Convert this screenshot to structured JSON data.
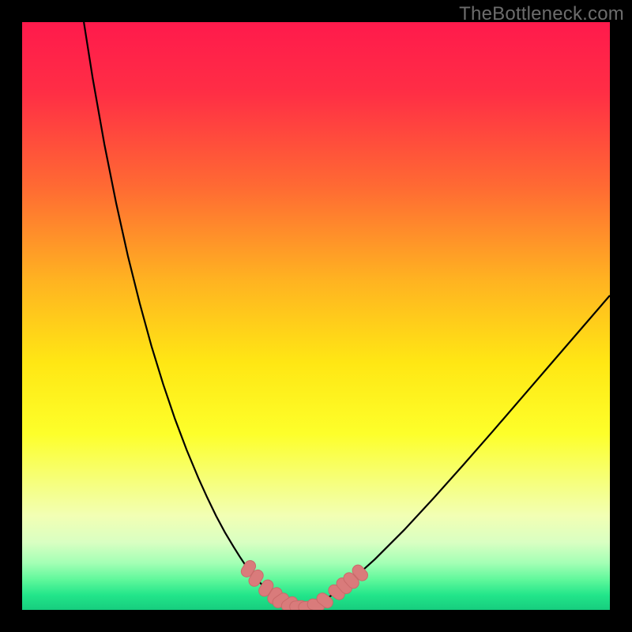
{
  "watermark": "TheBottleneck.com",
  "colors": {
    "frame": "#000000",
    "gradient_stops": [
      {
        "offset": 0.0,
        "color": "#ff1a4c"
      },
      {
        "offset": 0.12,
        "color": "#ff2e45"
      },
      {
        "offset": 0.28,
        "color": "#ff6a33"
      },
      {
        "offset": 0.44,
        "color": "#ffb321"
      },
      {
        "offset": 0.58,
        "color": "#ffe714"
      },
      {
        "offset": 0.7,
        "color": "#fdff2a"
      },
      {
        "offset": 0.78,
        "color": "#f6ff7a"
      },
      {
        "offset": 0.84,
        "color": "#f2ffb4"
      },
      {
        "offset": 0.885,
        "color": "#d9ffc2"
      },
      {
        "offset": 0.92,
        "color": "#a4ffb5"
      },
      {
        "offset": 0.95,
        "color": "#5cf79a"
      },
      {
        "offset": 0.975,
        "color": "#22e58a"
      },
      {
        "offset": 1.0,
        "color": "#17cd7e"
      }
    ],
    "curve": "#000000",
    "marker_fill": "#d97b7b",
    "marker_stroke": "#c96a6a"
  },
  "chart_data": {
    "type": "line",
    "title": "",
    "xlabel": "",
    "ylabel": "",
    "xlim": [
      0,
      100
    ],
    "ylim": [
      0,
      100
    ],
    "grid": false,
    "legend": false,
    "x": [
      10.5,
      12,
      14,
      16,
      18,
      20,
      22,
      24,
      26,
      28,
      30,
      31.5,
      33,
      34.5,
      36,
      37,
      38,
      39,
      40,
      41,
      42,
      43.5,
      45,
      47,
      49,
      51,
      53,
      56,
      60,
      65,
      70,
      75,
      80,
      85,
      90,
      95,
      100
    ],
    "y": [
      100,
      90.5,
      79.2,
      69.2,
      60.2,
      52.2,
      44.9,
      38.4,
      32.5,
      27.2,
      22.4,
      19.1,
      16.0,
      13.2,
      10.7,
      9.1,
      7.6,
      6.3,
      5.1,
      4.1,
      3.2,
      2.1,
      1.2,
      0.5,
      0.5,
      1.4,
      2.7,
      5.0,
      8.6,
      13.6,
      19.0,
      24.6,
      30.3,
      36.1,
      41.9,
      47.7,
      53.5
    ],
    "markers": [
      {
        "x": 38.5,
        "y": 7.0
      },
      {
        "x": 39.8,
        "y": 5.4
      },
      {
        "x": 41.5,
        "y": 3.7
      },
      {
        "x": 43.0,
        "y": 2.4
      },
      {
        "x": 44.0,
        "y": 1.6
      },
      {
        "x": 45.5,
        "y": 1.0
      },
      {
        "x": 47.0,
        "y": 0.6
      },
      {
        "x": 48.5,
        "y": 0.5
      },
      {
        "x": 50.0,
        "y": 0.8
      },
      {
        "x": 51.5,
        "y": 1.6
      },
      {
        "x": 53.5,
        "y": 3.0
      },
      {
        "x": 54.8,
        "y": 4.1
      },
      {
        "x": 56.0,
        "y": 5.0
      },
      {
        "x": 57.5,
        "y": 6.3
      }
    ]
  }
}
